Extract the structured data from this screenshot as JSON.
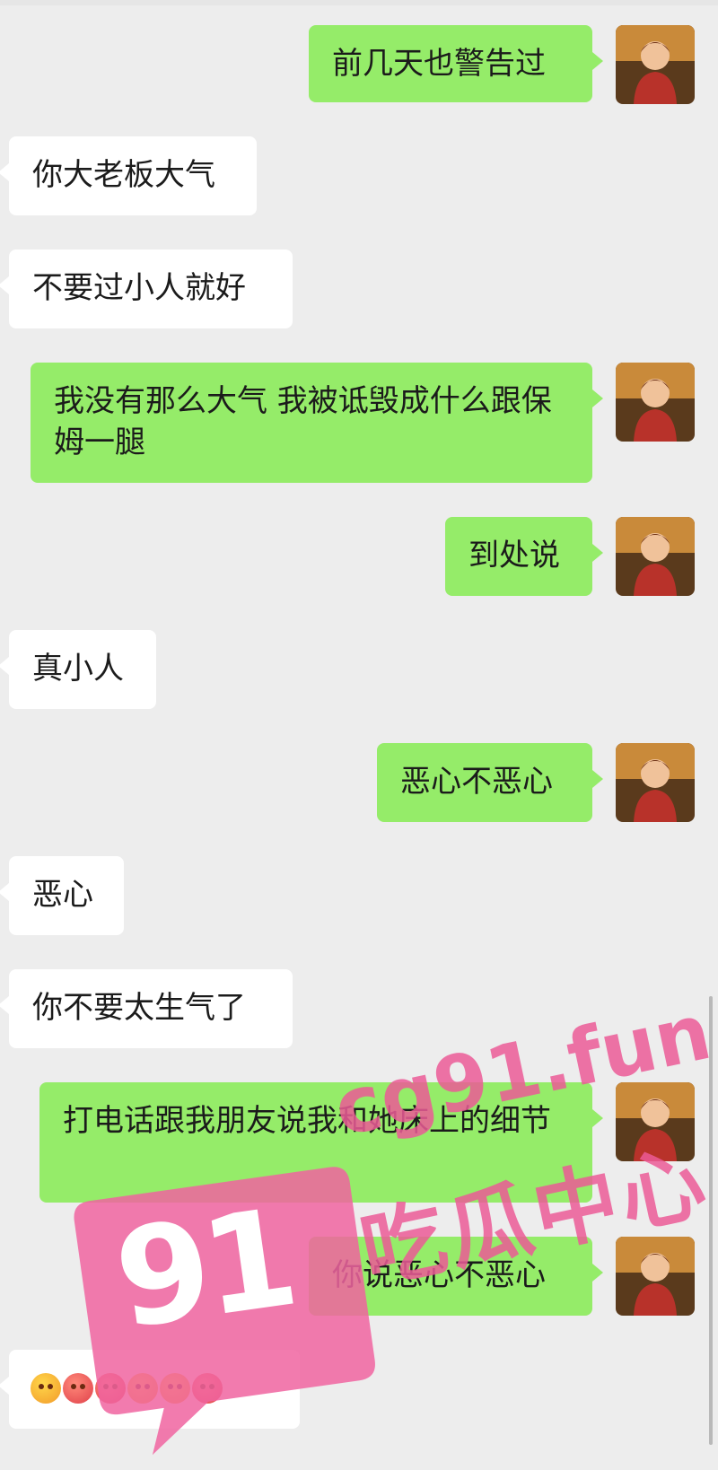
{
  "messages": [
    {
      "side": "right",
      "text": "前几天也警告过"
    },
    {
      "side": "left",
      "text": "你大老板大气"
    },
    {
      "side": "left",
      "text": "不要过小人就好"
    },
    {
      "side": "right",
      "text": "我没有那么大气 我被诋毁成什么跟保姆一腿"
    },
    {
      "side": "right",
      "text": "到处说"
    },
    {
      "side": "left",
      "text": "真小人"
    },
    {
      "side": "right",
      "text": "恶心不恶心"
    },
    {
      "side": "left",
      "text": "恶心"
    },
    {
      "side": "left",
      "text": "你不要太生气了"
    },
    {
      "side": "right",
      "text": "打电话跟我朋友说我和她床上的细节"
    },
    {
      "side": "right",
      "text": "你说恶心不恶心"
    },
    {
      "side": "left",
      "emoji": [
        "pleading-face",
        "flushed-face",
        "flushed-face",
        "woozy-face",
        "face-exhaling",
        "face-with-symbols"
      ]
    }
  ],
  "watermark": {
    "badge_number": "91",
    "url": "cg91.fun",
    "slogan": "吃瓜中心",
    "color": "#eb5a96"
  },
  "colors": {
    "background": "#ededed",
    "right_bubble": "#95ec69",
    "left_bubble": "#ffffff"
  }
}
